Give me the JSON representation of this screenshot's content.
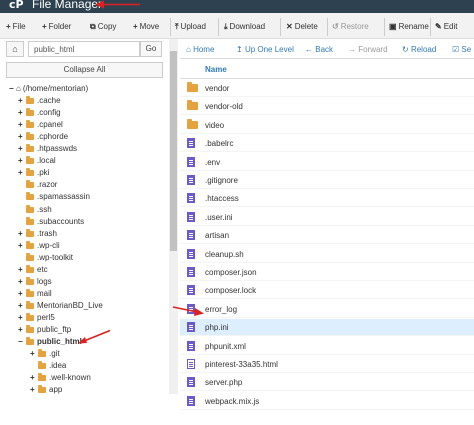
{
  "header": {
    "logo": "cP",
    "title": "File Manager"
  },
  "toolbar": {
    "items": [
      {
        "icon": "+",
        "label": "File"
      },
      {
        "icon": "+",
        "label": "Folder"
      },
      {
        "icon": "⧉",
        "label": "Copy"
      },
      {
        "icon": "+",
        "label": "Move"
      },
      {
        "icon": "⤒",
        "label": "Upload"
      },
      {
        "icon": "⤓",
        "label": "Download"
      },
      {
        "icon": "✕",
        "label": "Delete"
      },
      {
        "icon": "↺",
        "label": "Restore"
      },
      {
        "icon": "▣",
        "label": "Rename"
      },
      {
        "icon": "✎",
        "label": "Edit"
      }
    ]
  },
  "left_pane": {
    "home_icon": "⌂",
    "path_value": "public_html",
    "go_label": "Go",
    "collapse_label": "Collapse All",
    "tree": [
      {
        "toggle": "−",
        "label": "(/home/mentorian)",
        "home": true
      },
      {
        "toggle": "+",
        "label": ".cache"
      },
      {
        "toggle": "+",
        "label": ".config"
      },
      {
        "toggle": "+",
        "label": ".cpanel"
      },
      {
        "toggle": "+",
        "label": ".cphorde"
      },
      {
        "toggle": "+",
        "label": ".htpasswds"
      },
      {
        "toggle": "+",
        "label": ".local"
      },
      {
        "toggle": "+",
        "label": ".pki"
      },
      {
        "toggle": "",
        "label": ".razor"
      },
      {
        "toggle": "",
        "label": ".spamassassin"
      },
      {
        "toggle": "",
        "label": ".ssh"
      },
      {
        "toggle": "",
        "label": ".subaccounts"
      },
      {
        "toggle": "+",
        "label": ".trash"
      },
      {
        "toggle": "+",
        "label": ".wp-cli"
      },
      {
        "toggle": "",
        "label": ".wp-toolkit"
      },
      {
        "toggle": "+",
        "label": "etc"
      },
      {
        "toggle": "+",
        "label": "logs"
      },
      {
        "toggle": "+",
        "label": "mail"
      },
      {
        "toggle": "+",
        "label": "MentorianBD_Live"
      },
      {
        "toggle": "+",
        "label": "perl5"
      },
      {
        "toggle": "+",
        "label": "public_ftp"
      },
      {
        "toggle": "−",
        "label": "public_html",
        "bold": true
      },
      {
        "toggle": "+",
        "label": ".git",
        "child": true
      },
      {
        "toggle": "",
        "label": ".idea",
        "child": true
      },
      {
        "toggle": "+",
        "label": ".well-known",
        "child": true
      },
      {
        "toggle": "+",
        "label": "app",
        "child": true
      }
    ]
  },
  "right_pane": {
    "nav": [
      {
        "icon": "⌂",
        "label": "Home"
      },
      {
        "icon": "↥",
        "label": "Up One Level"
      },
      {
        "icon": "←",
        "label": "Back"
      },
      {
        "icon": "→",
        "label": "Forward"
      },
      {
        "icon": "↻",
        "label": "Reload"
      },
      {
        "icon": "☑",
        "label": "Se"
      }
    ],
    "column_name": "Name",
    "files": [
      {
        "name": "vendor",
        "type": "folder"
      },
      {
        "name": "vendor-old",
        "type": "folder"
      },
      {
        "name": "video",
        "type": "folder"
      },
      {
        "name": ".babelrc",
        "type": "file"
      },
      {
        "name": ".env",
        "type": "file"
      },
      {
        "name": ".gitignore",
        "type": "file"
      },
      {
        "name": ".htaccess",
        "type": "file"
      },
      {
        "name": ".user.ini",
        "type": "file"
      },
      {
        "name": "artisan",
        "type": "file"
      },
      {
        "name": "cleanup.sh",
        "type": "file"
      },
      {
        "name": "composer.json",
        "type": "file"
      },
      {
        "name": "composer.lock",
        "type": "file"
      },
      {
        "name": "error_log",
        "type": "file"
      },
      {
        "name": "php.ini",
        "type": "file",
        "selected": true
      },
      {
        "name": "phpunit.xml",
        "type": "file"
      },
      {
        "name": "pinterest-33a35.html",
        "type": "html"
      },
      {
        "name": "server.php",
        "type": "file"
      },
      {
        "name": "webpack.mix.js",
        "type": "file"
      }
    ]
  },
  "colors": {
    "header_bg": "#2d4150",
    "link": "#337ab7",
    "folder": "#e6a23c",
    "file_icon": "#6a5acd",
    "selected_row": "#ddeeff",
    "annotation": "#e02020"
  }
}
